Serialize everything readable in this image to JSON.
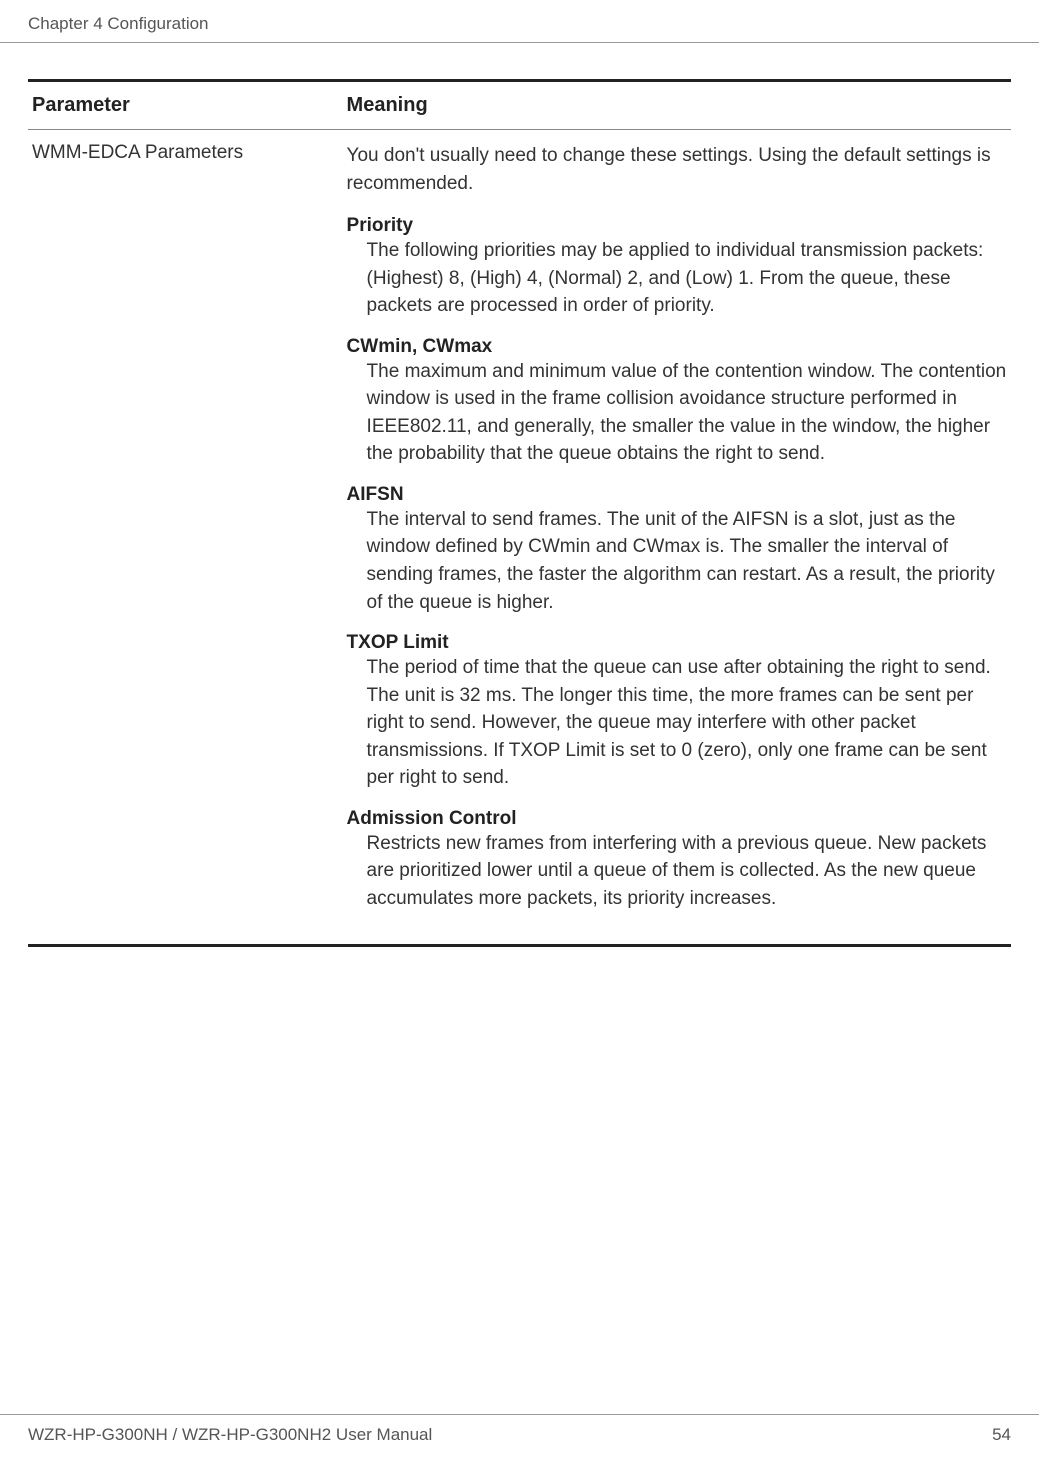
{
  "header": {
    "chapter": "Chapter 4  Configuration"
  },
  "table": {
    "headers": {
      "param": "Parameter",
      "meaning": "Meaning"
    },
    "row": {
      "param": "WMM-EDCA Parameters",
      "intro": "You don't usually need to change these settings. Using the default settings is recommended.",
      "defs": {
        "priority": {
          "title": "Priority",
          "body": " The following priorities may be applied to individual transmission packets:  (Highest) 8, (High) 4, (Normal) 2, and (Low) 1. From the queue, these packets are processed in order of priority."
        },
        "cwminmax": {
          "title": "CWmin, CWmax",
          "body": "The maximum and minimum value of the contention window. The contention window is used in the frame collision avoidance structure performed in IEEE802.11, and generally, the smaller the value in the window, the higher the probability that the queue obtains the right to send."
        },
        "aifsn": {
          "title": "AIFSN",
          "body": "The interval to send frames. The unit of the AIFSN is a slot, just as the window defined by CWmin and CWmax is. The smaller the interval of sending frames, the faster the algorithm can restart. As a result, the priority of the queue is higher."
        },
        "txop": {
          "title": "TXOP Limit",
          "body": "The period of time that the queue can use after obtaining the right to send. The unit is 32 ms. The longer this time, the more frames can be sent per right to send. However, the queue may interfere with other packet transmissions. If TXOP Limit is set to 0 (zero), only one frame can be sent per right to send."
        },
        "admission": {
          "title": "Admission Control",
          "body": "Restricts new frames from interfering with a previous queue. New packets are prioritized lower until a queue of them is collected. As the new queue accumulates more packets, its priority increases."
        }
      }
    }
  },
  "footer": {
    "manual": "WZR-HP-G300NH / WZR-HP-G300NH2 User Manual",
    "page": "54"
  }
}
